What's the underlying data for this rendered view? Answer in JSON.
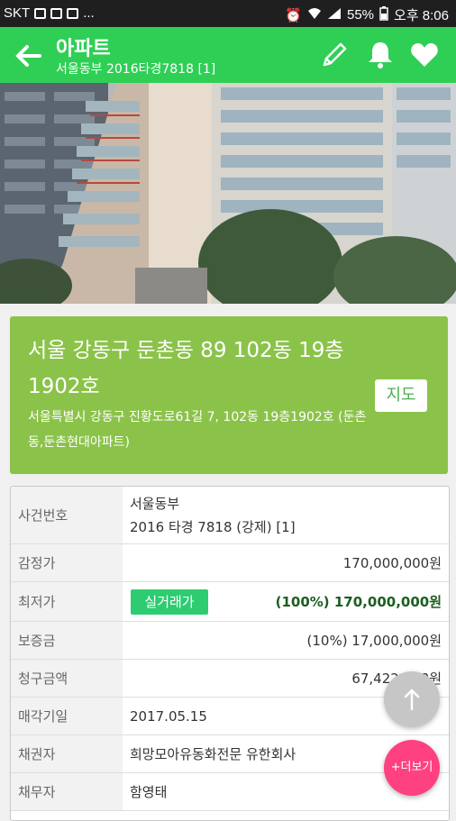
{
  "status_bar": {
    "carrier": "SKT",
    "overflow": "...",
    "battery_percent": "55%",
    "time": "오후 8:06"
  },
  "app_bar": {
    "title": "아파트",
    "subtitle": "서울동부 2016타경7818 [1]",
    "color": "#2fcf55",
    "icons": [
      "back-arrow-icon",
      "pencil-icon",
      "bell-icon",
      "heart-icon"
    ]
  },
  "address_card": {
    "title": "서울 강동구 둔촌동 89 102동 19층 1902호",
    "detail": "서울특별시 강동구 진황도로61길 7, 102동 19층1902호 (둔촌동,둔촌현대아파트)",
    "map_button": "지도",
    "color": "#8bc34a"
  },
  "details": {
    "case_number": {
      "label": "사건번호",
      "line1": "서울동부",
      "line2": "2016 타경 7818 (강제) [1]"
    },
    "appraisal": {
      "label": "감정가",
      "value": "170,000,000원"
    },
    "minimum": {
      "label": "최저가",
      "badge": "실거래가",
      "value": "(100%) 170,000,000원"
    },
    "deposit": {
      "label": "보증금",
      "value": "(10%) 17,000,000원"
    },
    "claim": {
      "label": "청구금액",
      "value": "67,422,688원"
    },
    "sale_date": {
      "label": "매각기일",
      "value": "2017.05.15"
    },
    "creditor": {
      "label": "채권자",
      "value": "희망모아유동화전문 유한회사"
    },
    "debtor": {
      "label": "채무자",
      "value": "함영태"
    }
  },
  "fabs": {
    "more_label": "+더보기",
    "accent": "#ff4081"
  }
}
